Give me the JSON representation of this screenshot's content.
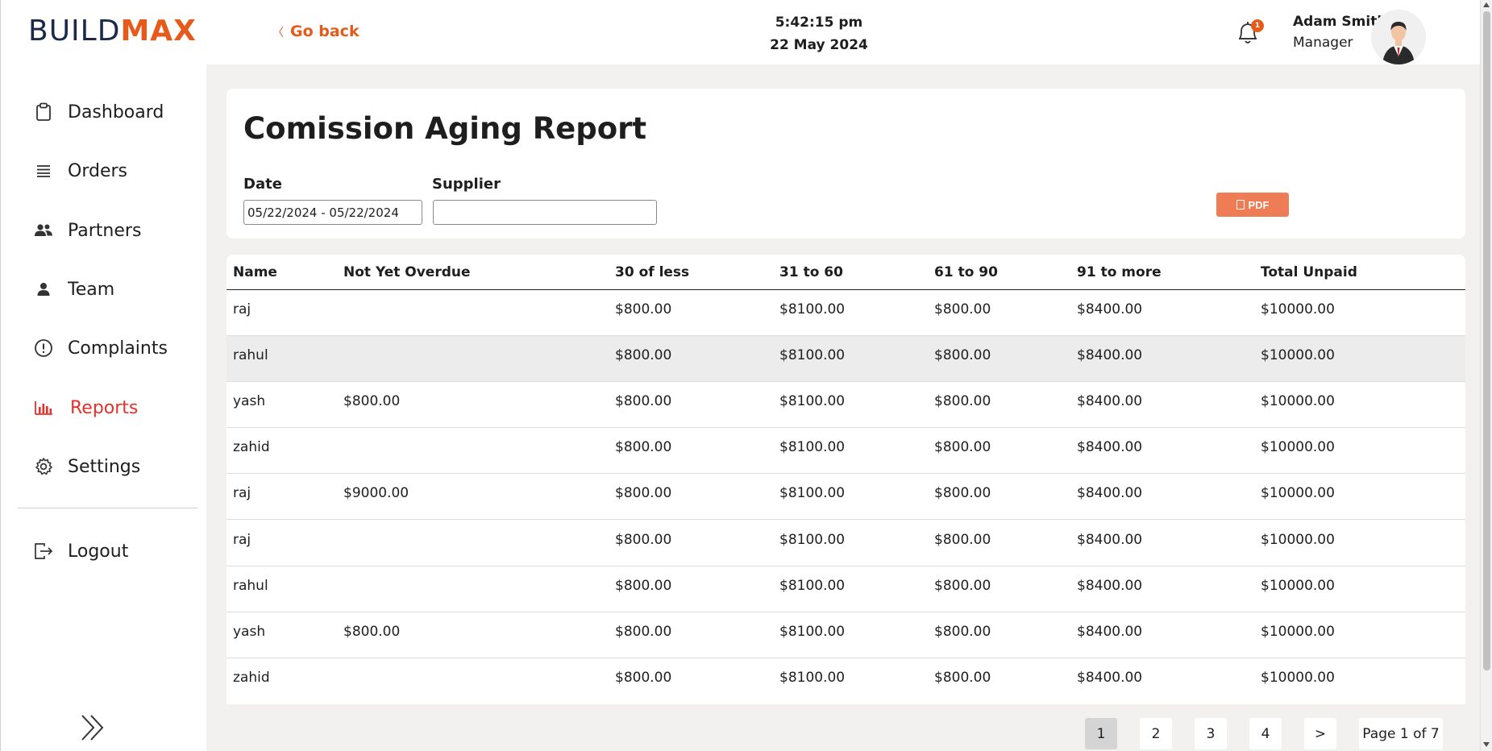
{
  "logo": {
    "part1": "BUILD",
    "part2": "MAX"
  },
  "sidebar": {
    "items": [
      {
        "label": "Dashboard",
        "icon": "clipboard-icon"
      },
      {
        "label": "Orders",
        "icon": "list-icon"
      },
      {
        "label": "Partners",
        "icon": "partners-icon"
      },
      {
        "label": "Team",
        "icon": "person-icon"
      },
      {
        "label": "Complaints",
        "icon": "alert-circle-icon"
      },
      {
        "label": "Reports",
        "icon": "bar-chart-icon",
        "active": true
      },
      {
        "label": "Settings",
        "icon": "gear-icon"
      }
    ],
    "logout_label": "Logout",
    "expand_icon": "double-chevron-right-icon"
  },
  "header": {
    "go_back": "Go back",
    "time": "5:42:15 pm",
    "date": "22 May 2024",
    "notification_count": "1",
    "user_name": "Adam Smith",
    "user_role": "Manager"
  },
  "report": {
    "title": "Comission Aging Report",
    "date_label": "Date",
    "date_value": "05/22/2024 - 05/22/2024",
    "supplier_label": "Supplier",
    "supplier_value": "",
    "pdf_label": "PDF"
  },
  "table": {
    "columns": [
      "Name",
      "Not Yet Overdue",
      "30 of less",
      "31 to 60",
      "61 to 90",
      "91 to more",
      "Total Unpaid"
    ],
    "rows": [
      [
        "raj",
        "",
        "$800.00",
        "$8100.00",
        "$800.00",
        "$8400.00",
        "$10000.00"
      ],
      [
        "rahul",
        "",
        "$800.00",
        "$8100.00",
        "$800.00",
        "$8400.00",
        "$10000.00"
      ],
      [
        "yash",
        "$800.00",
        "$800.00",
        "$8100.00",
        "$800.00",
        "$8400.00",
        "$10000.00"
      ],
      [
        "zahid",
        "",
        "$800.00",
        "$8100.00",
        "$800.00",
        "$8400.00",
        "$10000.00"
      ],
      [
        "raj",
        "$9000.00",
        "$800.00",
        "$8100.00",
        "$800.00",
        "$8400.00",
        "$10000.00"
      ],
      [
        "raj",
        "",
        "$800.00",
        "$8100.00",
        "$800.00",
        "$8400.00",
        "$10000.00"
      ],
      [
        "rahul",
        "",
        "$800.00",
        "$8100.00",
        "$800.00",
        "$8400.00",
        "$10000.00"
      ],
      [
        "yash",
        "$800.00",
        "$800.00",
        "$8100.00",
        "$800.00",
        "$8400.00",
        "$10000.00"
      ],
      [
        "zahid",
        "",
        "$800.00",
        "$8100.00",
        "$800.00",
        "$8400.00",
        "$10000.00"
      ]
    ]
  },
  "pagination": {
    "pages": [
      "1",
      "2",
      "3",
      "4"
    ],
    "current": "1",
    "next": ">",
    "summary": "Page 1 of 7"
  },
  "colors": {
    "accent": "#e65a1c",
    "active_nav": "#e8302a",
    "pdf_button": "#ee7c55",
    "logo_dark": "#1c2a4a",
    "background": "#f3f1f0"
  }
}
